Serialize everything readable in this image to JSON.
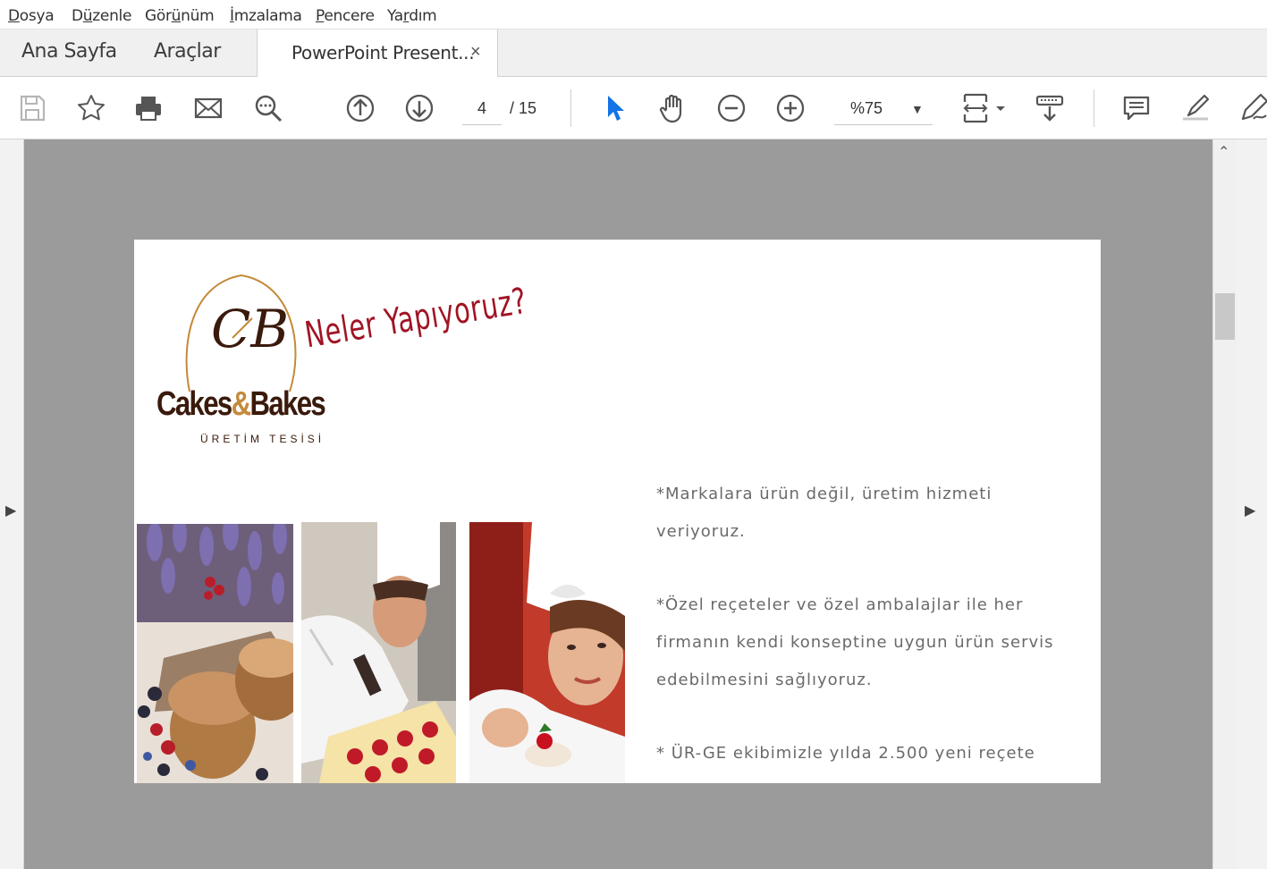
{
  "menu": [
    {
      "label": "Dosya",
      "underline": "D",
      "rest": "osya"
    },
    {
      "label": "Düzenle",
      "underline": "ü",
      "pre": "D",
      "rest": "zenle"
    },
    {
      "label": "Görünüm",
      "underline": "ü",
      "pre": "Gör",
      "rest": "nüm"
    },
    {
      "label": "İmzalama",
      "underline": "İ",
      "pre": "",
      "rest": "mzalama"
    },
    {
      "label": "Pencere",
      "underline": "P",
      "pre": "",
      "rest": "encere"
    },
    {
      "label": "Yardım",
      "underline": "r",
      "pre": "Ya",
      "rest": "dım"
    }
  ],
  "tabs": {
    "home": "Ana Sayfa",
    "tools": "Araçlar",
    "document": "PowerPoint Present...",
    "close": "×"
  },
  "toolbar": {
    "page_current": "4",
    "page_total": "/  15",
    "zoom": "%75",
    "zoom_arrow": "▼",
    "accent_color": "#1473e6"
  },
  "scroll": {
    "up_arrow": "⌃",
    "left_expand": "▶",
    "right_expand": "▶"
  },
  "slide": {
    "brand": "Cakes",
    "brand_amp": "&",
    "brand_end": "Bakes",
    "brand_sub": "ÜRETİM TESİSİ",
    "monogram": "CB",
    "title": "Neler Yapıyoruz?",
    "paragraphs": [
      "*Markalara ürün değil, üretim  hizmeti veriyoruz.",
      "*Özel reçeteler ve özel ambalajlar ile her firmanın kendi konseptine uygun ürün servis edebilmesini sağlıyoruz.",
      "* ÜR-GE ekibimizle yılda 2.500 yeni  reçete"
    ],
    "title_color": "#a01424",
    "brand_color": "#3a1a0c",
    "accent_gold": "#c38a3a"
  }
}
